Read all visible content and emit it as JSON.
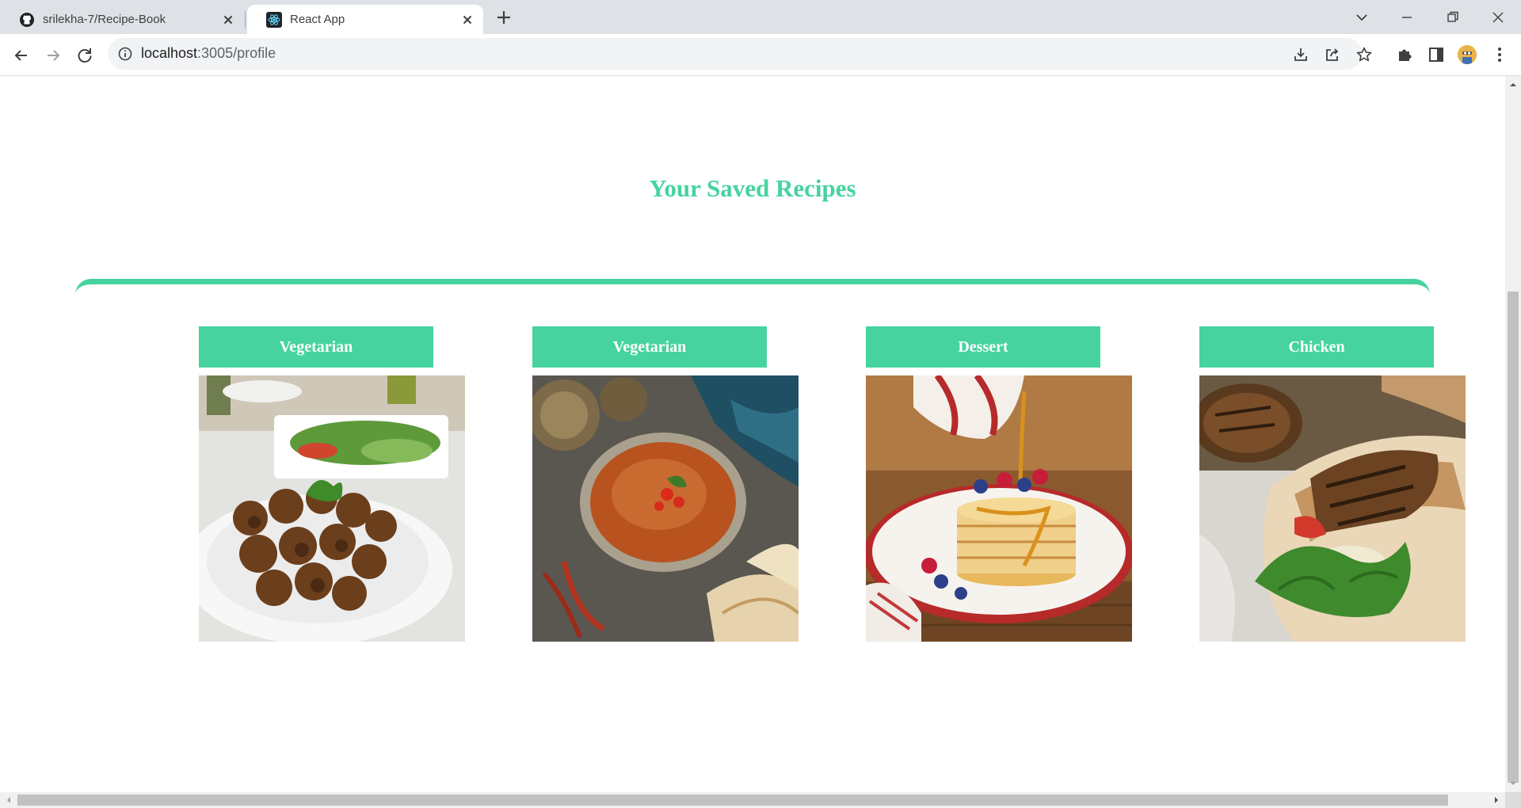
{
  "browser": {
    "tabs": [
      {
        "title": "srilekha-7/Recipe-Book",
        "icon": "github-icon",
        "active": false
      },
      {
        "title": "React App",
        "icon": "react-icon",
        "active": true
      }
    ],
    "url_host": "localhost",
    "url_path": ":3005/profile"
  },
  "page": {
    "title": "Your Saved Recipes",
    "accent_color": "#46d39f",
    "recipes": [
      {
        "category": "Vegetarian",
        "image": "falafel-with-salad"
      },
      {
        "category": "Vegetarian",
        "image": "lentil-soup-with-naan"
      },
      {
        "category": "Dessert",
        "image": "pancakes-with-berries-and-syrup"
      },
      {
        "category": "Chicken",
        "image": "grilled-chicken-wrap"
      }
    ]
  }
}
